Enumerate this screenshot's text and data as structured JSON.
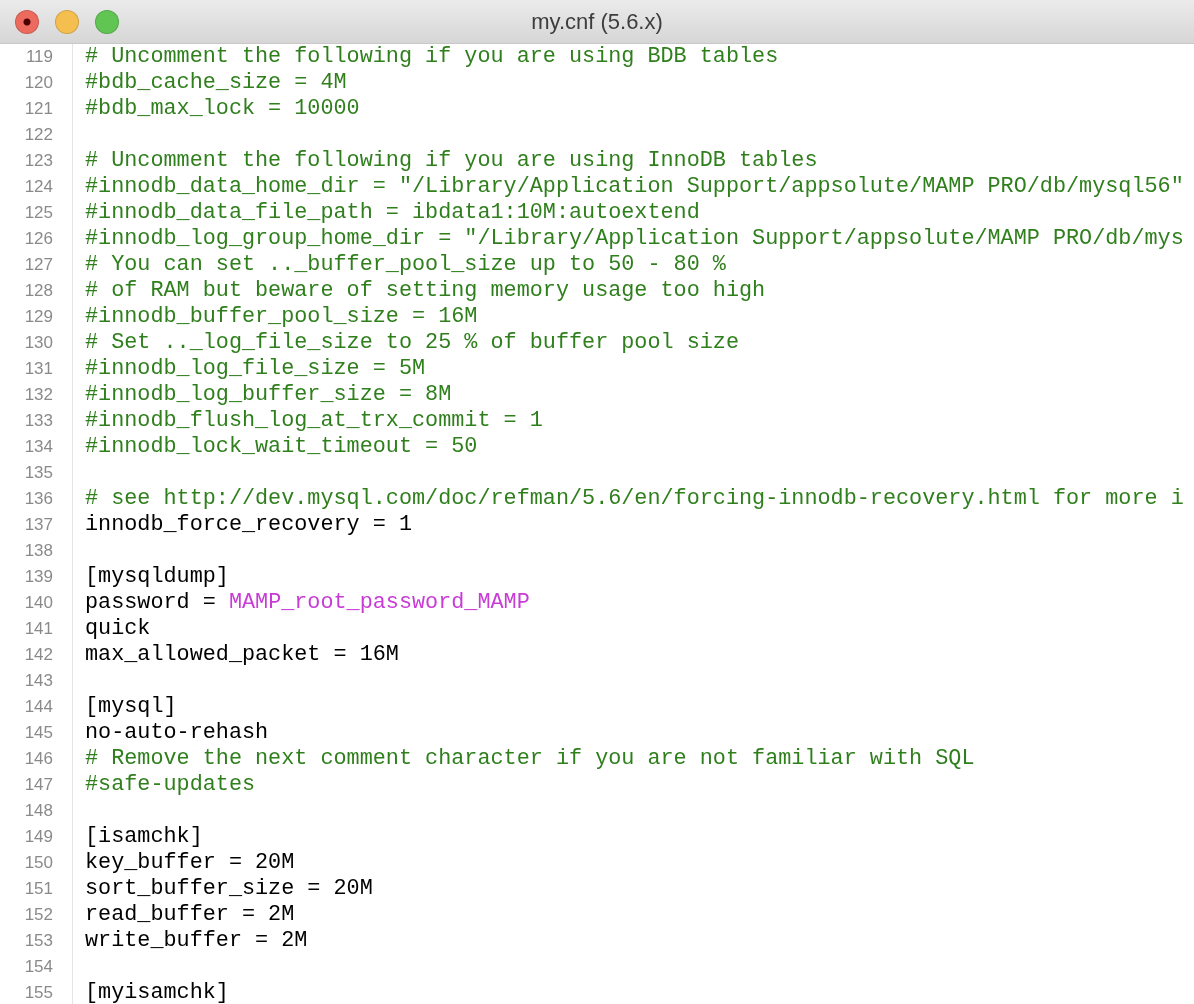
{
  "window": {
    "title": "my.cnf (5.6.x)"
  },
  "lines": [
    {
      "number": "119",
      "segments": [
        {
          "text": "# Uncomment the following if you are using BDB tables",
          "kind": "comment"
        }
      ]
    },
    {
      "number": "120",
      "segments": [
        {
          "text": "#bdb_cache_size = 4M",
          "kind": "comment"
        }
      ]
    },
    {
      "number": "121",
      "segments": [
        {
          "text": "#bdb_max_lock = 10000",
          "kind": "comment"
        }
      ]
    },
    {
      "number": "122"
    },
    {
      "number": "123",
      "segments": [
        {
          "text": "# Uncomment the following if you are using InnoDB tables",
          "kind": "comment"
        }
      ]
    },
    {
      "number": "124",
      "segments": [
        {
          "text": "#innodb_data_home_dir = \"/Library/Application Support/appsolute/MAMP PRO/db/mysql56\"",
          "kind": "comment"
        }
      ]
    },
    {
      "number": "125",
      "segments": [
        {
          "text": "#innodb_data_file_path = ibdata1:10M:autoextend",
          "kind": "comment"
        }
      ]
    },
    {
      "number": "126",
      "segments": [
        {
          "text": "#innodb_log_group_home_dir = \"/Library/Application Support/appsolute/MAMP PRO/db/mys",
          "kind": "comment"
        }
      ]
    },
    {
      "number": "127",
      "segments": [
        {
          "text": "# You can set .._buffer_pool_size up to 50 - 80 %",
          "kind": "comment"
        }
      ]
    },
    {
      "number": "128",
      "segments": [
        {
          "text": "# of RAM but beware of setting memory usage too high",
          "kind": "comment"
        }
      ]
    },
    {
      "number": "129",
      "segments": [
        {
          "text": "#innodb_buffer_pool_size = 16M",
          "kind": "comment"
        }
      ]
    },
    {
      "number": "130",
      "segments": [
        {
          "text": "# Set .._log_file_size to 25 % of buffer pool size",
          "kind": "comment"
        }
      ]
    },
    {
      "number": "131",
      "segments": [
        {
          "text": "#innodb_log_file_size = 5M",
          "kind": "comment"
        }
      ]
    },
    {
      "number": "132",
      "segments": [
        {
          "text": "#innodb_log_buffer_size = 8M",
          "kind": "comment"
        }
      ]
    },
    {
      "number": "133",
      "segments": [
        {
          "text": "#innodb_flush_log_at_trx_commit = 1",
          "kind": "comment"
        }
      ]
    },
    {
      "number": "134",
      "segments": [
        {
          "text": "#innodb_lock_wait_timeout = 50",
          "kind": "comment"
        }
      ]
    },
    {
      "number": "135"
    },
    {
      "number": "136",
      "segments": [
        {
          "text": "# see http://dev.mysql.com/doc/refman/5.6/en/forcing-innodb-recovery.html for more i",
          "kind": "comment"
        }
      ]
    },
    {
      "number": "137",
      "segments": [
        {
          "text": "innodb_force_recovery = 1",
          "kind": "plain"
        }
      ]
    },
    {
      "number": "138"
    },
    {
      "number": "139",
      "segments": [
        {
          "text": "[mysqldump]",
          "kind": "plain"
        }
      ]
    },
    {
      "number": "140",
      "segments": [
        {
          "text": "password = ",
          "kind": "plain"
        },
        {
          "text": "MAMP_root_password_MAMP",
          "kind": "value"
        }
      ]
    },
    {
      "number": "141",
      "segments": [
        {
          "text": "quick",
          "kind": "plain"
        }
      ]
    },
    {
      "number": "142",
      "segments": [
        {
          "text": "max_allowed_packet = 16M",
          "kind": "plain"
        }
      ]
    },
    {
      "number": "143"
    },
    {
      "number": "144",
      "segments": [
        {
          "text": "[mysql]",
          "kind": "plain"
        }
      ]
    },
    {
      "number": "145",
      "segments": [
        {
          "text": "no-auto-rehash",
          "kind": "plain"
        }
      ]
    },
    {
      "number": "146",
      "segments": [
        {
          "text": "# Remove the next comment character if you are not familiar with SQL",
          "kind": "comment"
        }
      ]
    },
    {
      "number": "147",
      "segments": [
        {
          "text": "#safe-updates",
          "kind": "comment"
        }
      ]
    },
    {
      "number": "148"
    },
    {
      "number": "149",
      "segments": [
        {
          "text": "[isamchk]",
          "kind": "plain"
        }
      ]
    },
    {
      "number": "150",
      "segments": [
        {
          "text": "key_buffer = 20M",
          "kind": "plain"
        }
      ]
    },
    {
      "number": "151",
      "segments": [
        {
          "text": "sort_buffer_size = 20M",
          "kind": "plain"
        }
      ]
    },
    {
      "number": "152",
      "segments": [
        {
          "text": "read_buffer = 2M",
          "kind": "plain"
        }
      ]
    },
    {
      "number": "153",
      "segments": [
        {
          "text": "write_buffer = 2M",
          "kind": "plain"
        }
      ]
    },
    {
      "number": "154"
    },
    {
      "number": "155",
      "segments": [
        {
          "text": "[myisamchk]",
          "kind": "plain"
        }
      ]
    }
  ]
}
